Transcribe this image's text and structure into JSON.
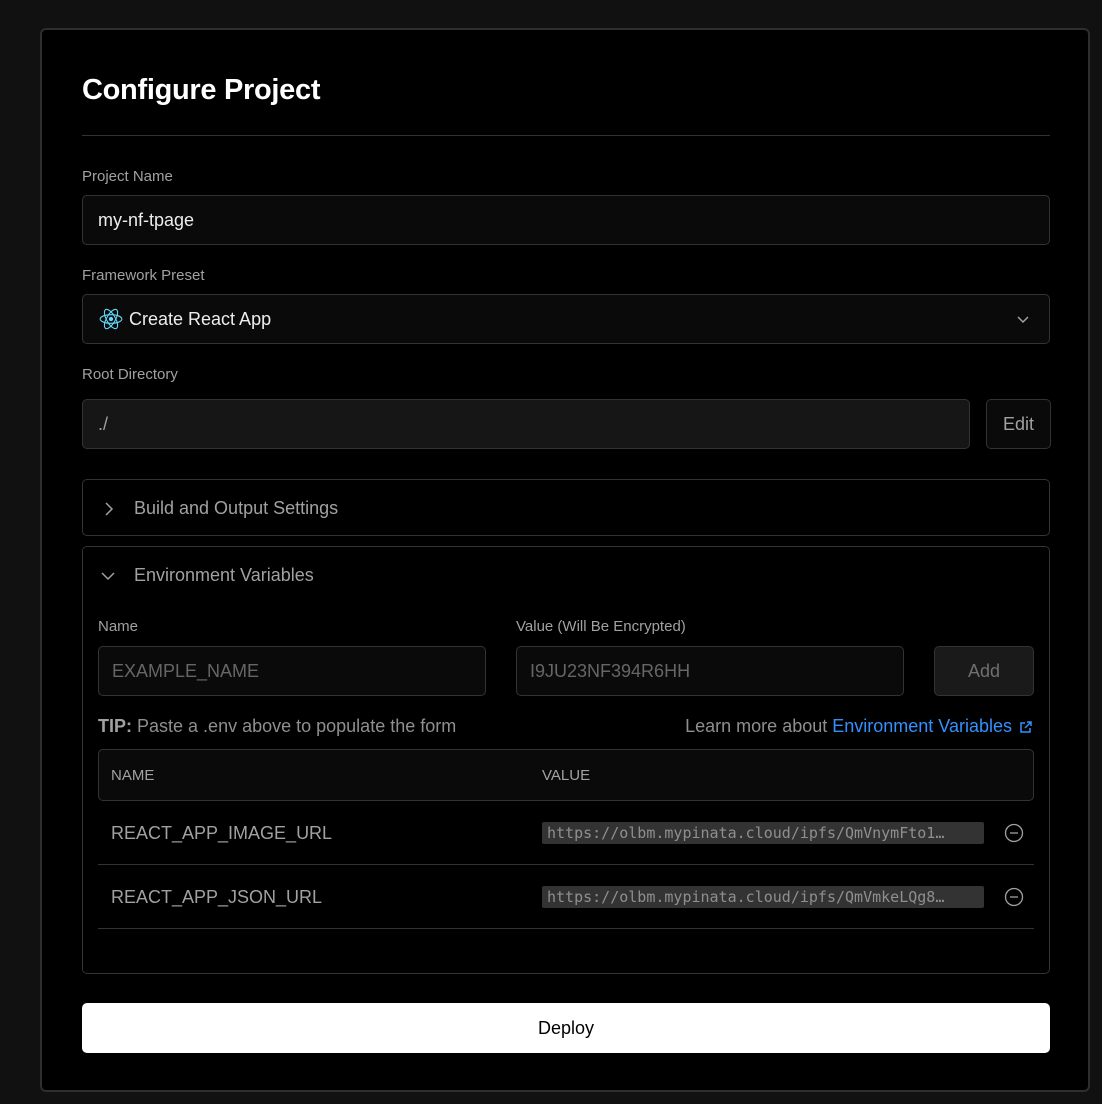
{
  "page": {
    "title": "Configure Project"
  },
  "project_name": {
    "label": "Project Name",
    "value": "my-nf-tpage"
  },
  "framework": {
    "label": "Framework Preset",
    "value": "Create React App",
    "icon": "react-icon"
  },
  "root_directory": {
    "label": "Root Directory",
    "value": "./",
    "edit_label": "Edit"
  },
  "build_settings": {
    "label": "Build and Output Settings"
  },
  "env": {
    "label": "Environment Variables",
    "name_label": "Name",
    "value_label": "Value (Will Be Encrypted)",
    "name_placeholder": "EXAMPLE_NAME",
    "value_placeholder": "I9JU23NF394R6HH",
    "add_label": "Add",
    "tip_prefix": "TIP:",
    "tip_text": "Paste a .env above to populate the form",
    "learn_prefix": "Learn more about",
    "learn_link": "Environment Variables",
    "table": {
      "headers": [
        "NAME",
        "VALUE"
      ],
      "rows": [
        {
          "name": "REACT_APP_IMAGE_URL",
          "value": "https://olbm.mypinata.cloud/ipfs/QmVnymFto1…"
        },
        {
          "name": "REACT_APP_JSON_URL",
          "value": "https://olbm.mypinata.cloud/ipfs/QmVmkeLQg8…"
        }
      ]
    }
  },
  "deploy": {
    "label": "Deploy"
  },
  "colors": {
    "link": "#3291ff",
    "background": "#000000",
    "border": "#333333",
    "react": "#61dafb"
  }
}
